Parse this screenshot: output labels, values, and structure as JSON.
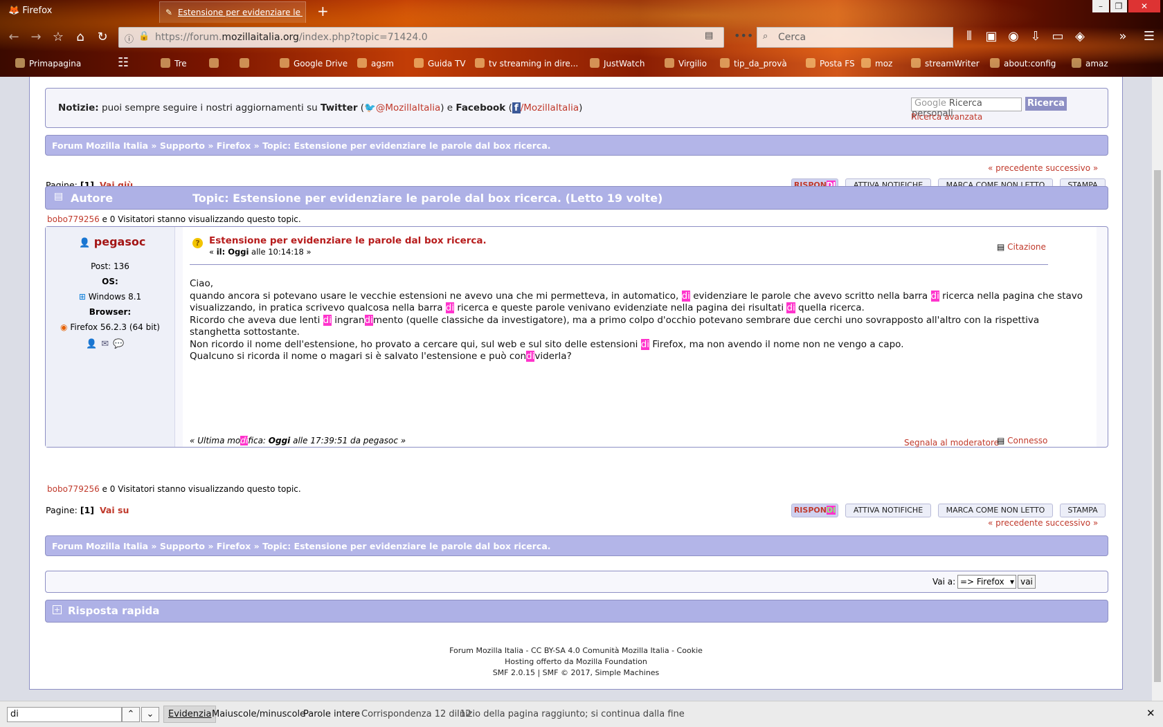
{
  "window": {
    "title": "Firefox",
    "tab_title": "Estensione per evidenziare le parol",
    "newtab": "+"
  },
  "nav": {
    "url_prefix": "https://forum.",
    "url_domain": "mozillaitalia.org",
    "url_path": "/index.php?topic=71424.0",
    "search_placeholder": "Cerca"
  },
  "bookmarks": [
    "Primapagina",
    "Tre",
    "Google Drive",
    "agsm",
    "Guida TV",
    "tv streaming in dire...",
    "JustWatch",
    "Virgilio",
    "tip_da_provà",
    "Posta FS",
    "moz",
    "streamWriter",
    "about:config",
    "amaz"
  ],
  "news": {
    "label": "Notizie:",
    "text1": " puoi sempre seguire i nostri aggiornamenti su ",
    "twitter": "Twitter",
    "open1": " (",
    "twitter_handle": "@MozillaItalia",
    "mid": ") e ",
    "facebook": "Facebook",
    "open2": " (",
    "fb_handle": "/MozillaItalia",
    "close": ")",
    "search_placeholder": "Ricerca personali",
    "search_brand": "Google",
    "search_button": "Ricerca",
    "advanced": "Ricerca avanzata"
  },
  "breadcrumb": {
    "home": "Forum Mozilla Italia",
    "sep": " » ",
    "support": "Supporto",
    "firefox": "Firefox",
    "topic": "Topic: Estensione per evidenziare le parole dal box ricerca."
  },
  "pager": {
    "prevnext": "« precedente successivo »",
    "pages_label": "Pagine:",
    "current": "[1]",
    "go_down": "Vai giù",
    "go_up": "Vai su"
  },
  "buttons": {
    "reply_a": "RISPON",
    "reply_b": "DI",
    "notify": "ATTIVA NOTIFICHE",
    "unread": "MARCA COME NON LETTO",
    "print": "STAMPA"
  },
  "header": {
    "author": "Autore",
    "topic": "Topic: Estensione per evidenziare le parole dal box ricerca.  (Letto 19 volte)"
  },
  "viewers": {
    "user": "bobo779256",
    "text": " e 0 Visitatori stanno visualizzando questo topic."
  },
  "poster": {
    "name": "pegasoc",
    "posts": "Post: 136",
    "os_label": "OS:",
    "os": "Windows 8.1",
    "browser_label": "Browser:",
    "browser": "Firefox 56.2.3 (64 bit)"
  },
  "post": {
    "subject": "Estensione per evidenziare le parole dal box ricerca.",
    "date_pre": "« ",
    "date_il": "il: ",
    "date_day": "Oggi",
    "date_rest": " alle 10:14:18 »",
    "quote": "Citazione",
    "edit_pre": "« Ultima mo",
    "edit_hl": "di",
    "edit_mid": "fica: ",
    "edit_day": "Oggi",
    "edit_rest": " alle 17:39:51 da pegasoc »",
    "report": "Segnala al moderatore",
    "logged": "Connesso"
  },
  "jump": {
    "label": "Vai a:",
    "value": "=> Firefox",
    "go": "vai"
  },
  "quickreply": "Risposta rapida",
  "footer": {
    "line1": "Forum Mozilla Italia - CC BY-SA 4.0 Comunità Mozilla Italia - Cookie",
    "line2": "Hosting offerto da Mozilla Foundation",
    "line3": "SMF 2.0.15 | SMF © 2017, Simple Machines"
  },
  "findbar": {
    "query": "di",
    "highlight": "Evidenzia",
    "case": "Maiuscole/minuscole",
    "whole": "Parole intere",
    "status": "Corrispondenza 12 di 12",
    "wrap": "Inizio della pagina raggiunto; si continua dalla fine"
  }
}
